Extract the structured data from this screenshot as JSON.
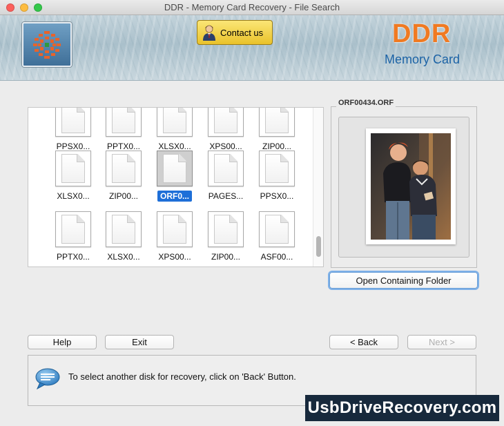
{
  "window": {
    "title": "DDR - Memory Card Recovery - File Search"
  },
  "header": {
    "contact_label": "Contact us",
    "brand_title": "DDR",
    "brand_subtitle": "Memory Card"
  },
  "file_grid": {
    "rows": [
      [
        "PPSX0...",
        "PPTX0...",
        "XLSX0...",
        "XPS00...",
        "ZIP00..."
      ],
      [
        "XLSX0...",
        "ZIP00...",
        "ORF0...",
        "PAGES...",
        "PPSX0..."
      ],
      [
        "PPTX0...",
        "XLSX0...",
        "XPS00...",
        "ZIP00...",
        "ASF00..."
      ]
    ],
    "selected": {
      "row": 1,
      "col": 2
    }
  },
  "preview": {
    "title": "ORF00434.ORF",
    "open_folder_label": "Open Containing Folder"
  },
  "buttons": {
    "help": "Help",
    "exit": "Exit",
    "back": "< Back",
    "next": "Next >"
  },
  "message": {
    "text": "To select another disk for recovery, click on 'Back' Button."
  },
  "watermark": {
    "text": "UsbDriveRecovery.com"
  },
  "colors": {
    "accent": "#1e6fd8",
    "brand_orange": "#f07a22",
    "brand_blue": "#1c63a6"
  }
}
